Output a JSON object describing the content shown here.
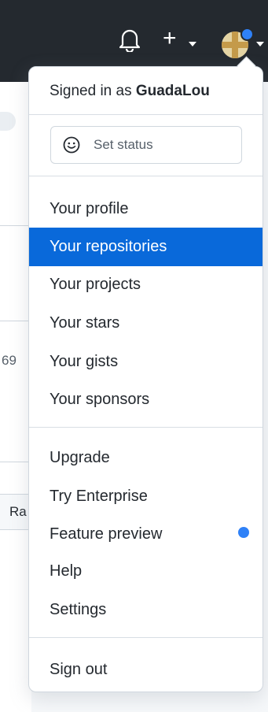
{
  "header": {
    "icons": [
      "bell-icon",
      "plus-icon",
      "chevron-down-icon",
      "avatar",
      "notification-dot-icon"
    ]
  },
  "background": {
    "fragment_1": "69",
    "fragment_2": "Ra"
  },
  "menu": {
    "signed_in_prefix": "Signed in as",
    "username": "GuadaLou",
    "set_status": "Set status",
    "section_1": [
      "Your profile",
      "Your repositories",
      "Your projects",
      "Your stars",
      "Your gists",
      "Your sponsors"
    ],
    "section_2": [
      "Upgrade",
      "Try Enterprise",
      "Feature preview",
      "Help",
      "Settings"
    ],
    "sign_out": "Sign out",
    "active_item": "Your repositories"
  },
  "colors": {
    "header_bg": "#24292f",
    "highlight": "#0969da",
    "dot": "#2f81f7"
  }
}
